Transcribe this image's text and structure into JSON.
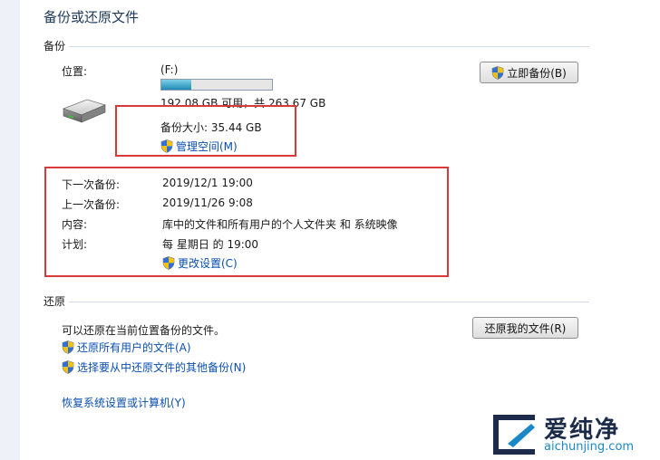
{
  "page_title": "备份或还原文件",
  "backup": {
    "section_title": "备份",
    "location_label": "位置:",
    "drive": "(F:)",
    "usage_fraction": 0.27,
    "space_text": "192.08 GB 可用，共 263.67 GB",
    "backup_size": "备份大小: 35.44 GB",
    "manage_space_link": "管理空间(M)",
    "backup_now_button": "立即备份(B)",
    "next_backup_label": "下一次备份:",
    "next_backup_value": "2019/12/1 19:00",
    "last_backup_label": "上一次备份:",
    "last_backup_value": "2019/11/26 9:08",
    "content_label": "内容:",
    "content_value": "库中的文件和所有用户的个人文件夹 和 系统映像",
    "schedule_label": "计划:",
    "schedule_value": "每 星期日 的 19:00",
    "change_settings_link": "更改设置(C)"
  },
  "restore": {
    "section_title": "还原",
    "description": "可以还原在当前位置备份的文件。",
    "restore_my_files_button": "还原我的文件(R)",
    "restore_all_users_link": "还原所有用户的文件(A)",
    "select_other_backup_link": "选择要从中还原文件的其他备份(N)",
    "recover_system_link": "恢复系统设置或计算机(Y)"
  },
  "watermark": {
    "brand": "爱纯净",
    "url": "aichunjing.com"
  },
  "colors": {
    "link": "#0b4fb0",
    "highlight_box": "#d93939",
    "title": "#1e395b"
  },
  "icons": [
    "shield-icon",
    "hard-drive-icon",
    "watermark-logo-icon"
  ]
}
